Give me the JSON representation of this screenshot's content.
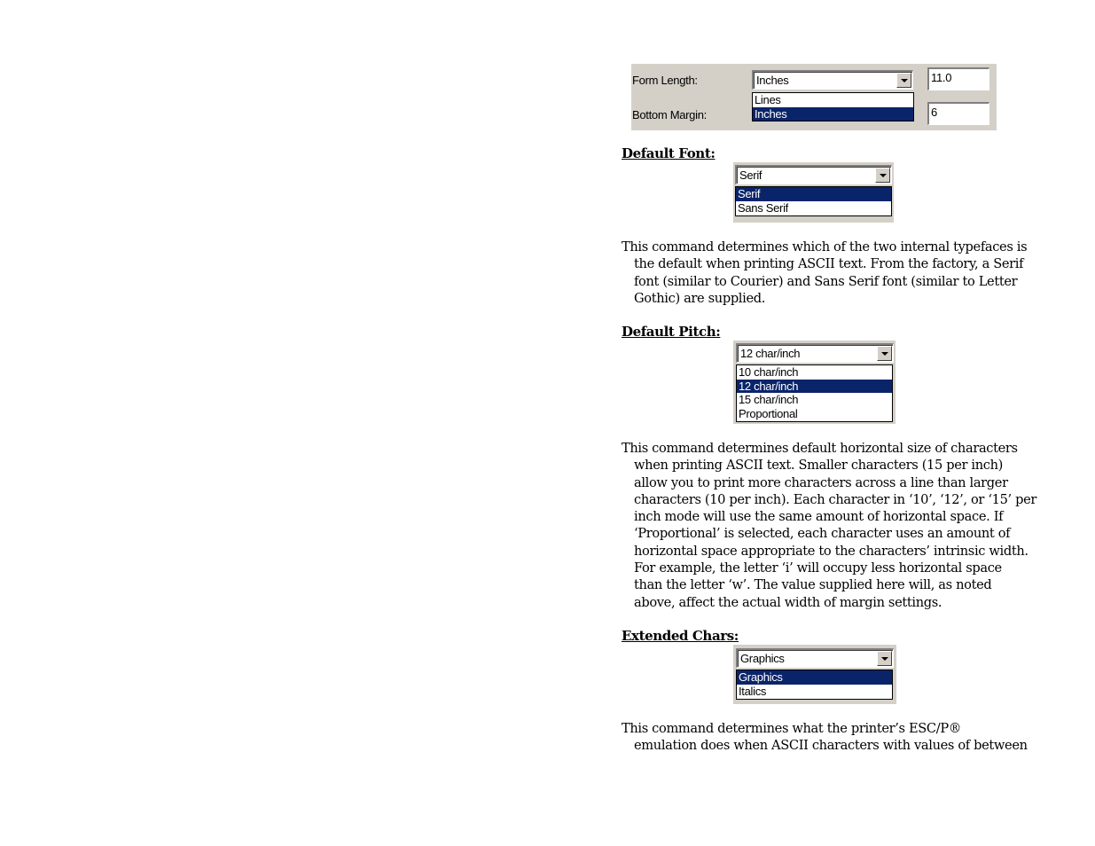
{
  "form_panel": {
    "form_length": {
      "label": "Form Length:",
      "unit_selected": "Inches",
      "unit_options": [
        {
          "label": "Lines",
          "selected": false
        },
        {
          "label": "Inches",
          "selected": true
        }
      ],
      "value": "11.0"
    },
    "bottom_margin": {
      "label": "Bottom Margin:",
      "value": "6"
    }
  },
  "sections": [
    {
      "heading": "Default Font:",
      "combo_selected": "Serif",
      "options": [
        {
          "label": "Serif",
          "selected": true
        },
        {
          "label": "Sans Serif",
          "selected": false
        }
      ],
      "paragraph_lines": [
        "This command determines which of the two internal typefaces is",
        "the default when printing ASCII text.  From the factory, a Serif",
        "font (similar to Courier) and Sans Serif font (similar to Letter",
        "Gothic) are supplied."
      ]
    },
    {
      "heading": "Default Pitch:",
      "combo_selected": "12 char/inch",
      "options": [
        {
          "label": "10 char/inch",
          "selected": false
        },
        {
          "label": "12 char/inch",
          "selected": true
        },
        {
          "label": "15 char/inch",
          "selected": false
        },
        {
          "label": "Proportional",
          "selected": false
        }
      ],
      "paragraph_lines": [
        "This command determines default horizontal size of characters",
        "when printing ASCII text.  Smaller characters (15 per inch)",
        "allow you to print more characters across a line than larger",
        "characters (10 per inch).  Each character in ‘10’, ‘12’, or ‘15’ per",
        "inch mode will use the same amount of horizontal space.  If",
        "‘Proportional’ is selected, each character uses an amount of",
        "horizontal space appropriate to the characters’ intrinsic width.",
        "For example, the letter ‘i’ will occupy less horizontal space",
        "than the letter ‘w’.  The value supplied here will, as noted",
        "above, affect the actual width of margin settings."
      ]
    },
    {
      "heading": "Extended Chars:",
      "combo_selected": "Graphics",
      "options": [
        {
          "label": "Graphics",
          "selected": true
        },
        {
          "label": "Italics",
          "selected": false
        }
      ],
      "paragraph_lines": [
        "This command determines what the printer’s ESC/P®",
        "emulation does when ASCII characters with values of between"
      ]
    }
  ],
  "icons": {
    "dropdown_arrow": "chevron-down-icon"
  },
  "colors": {
    "dialog_bg": "#d4d0c8",
    "selection_bg": "#0a246a",
    "selection_fg": "#ffffff"
  }
}
